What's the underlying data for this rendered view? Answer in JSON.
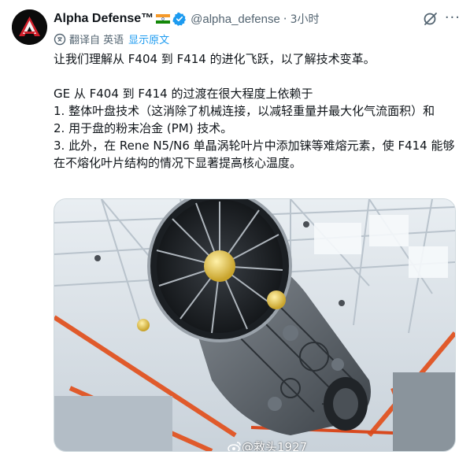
{
  "author": {
    "name": "Alpha Defense™",
    "handle": "@alpha_defense",
    "time": "3小时",
    "flag_icon": "india-flag-icon",
    "verified_icon": "verified-badge-icon",
    "verified_color": "#1d9bf0"
  },
  "translation": {
    "label": "翻译自 英语",
    "show_original": "显示原文"
  },
  "tweet": {
    "lines": [
      "让我们理解从 F404 到 F414 的进化飞跃，以了解技术变革。",
      "GE 从 F404 到 F414 的过渡在很大程度上依赖于",
      "1. 整体叶盘技术（这消除了机械连接，以减轻重量并最大化气流面积）和",
      "2. 用于盘的粉末冶金 (PM) 技术。",
      "3. 此外，在 Rene N5/N6 单晶涡轮叶片中添加铼等难熔元素，使 F414 能够在不熔化叶片结构的情况下显著提高核心温度。"
    ]
  },
  "media": {
    "watermark": "@救头1927",
    "accent_color": "#e05a2b"
  }
}
